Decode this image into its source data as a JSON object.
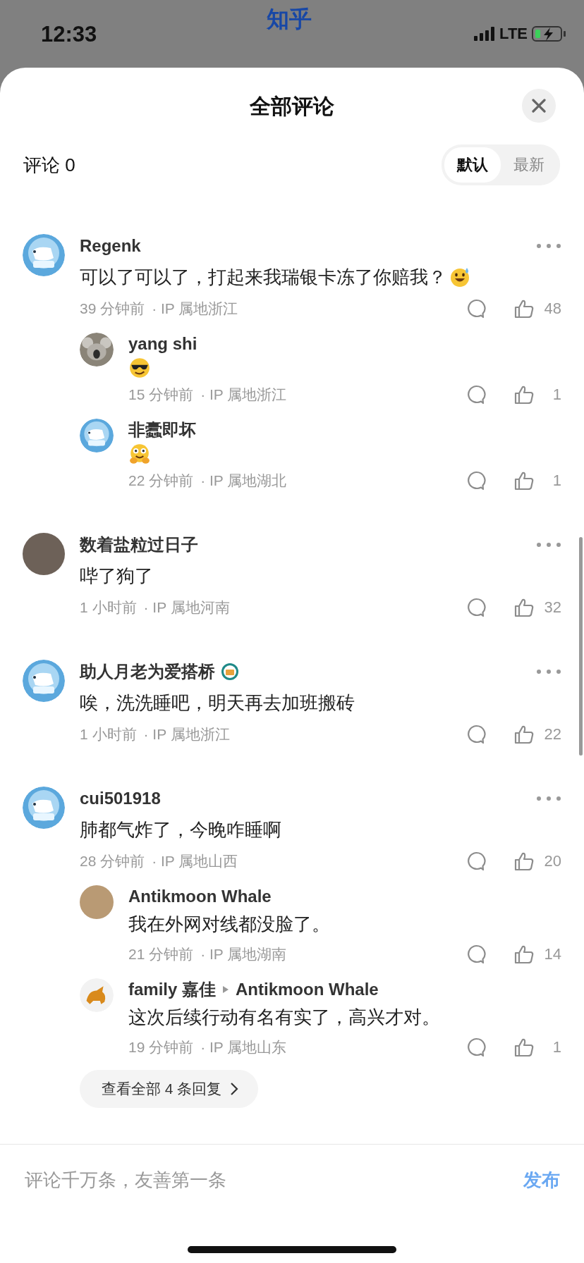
{
  "status_bar": {
    "time": "12:33",
    "app_label": "知乎",
    "network": "LTE"
  },
  "sheet": {
    "title": "全部评论",
    "count_label": "评论 0",
    "sort_tabs": [
      {
        "label": "默认",
        "selected": true
      },
      {
        "label": "最新",
        "selected": false
      }
    ]
  },
  "comments": [
    {
      "avatar": {
        "kind": "bear"
      },
      "name": "Regenk",
      "body": "可以了可以了，打起来我瑞银卡冻了你赔我？",
      "emoji": {
        "kind": "sweat"
      },
      "time": "39 分钟前",
      "location": "· IP 属地浙江",
      "likes": "48",
      "badge": false,
      "replies": [
        {
          "avatar": {
            "kind": "koala"
          },
          "name": "yang shi",
          "emoji": {
            "kind": "cool"
          },
          "time": "15 分钟前",
          "location": "· IP 属地浙江",
          "likes": "1"
        },
        {
          "avatar": {
            "kind": "bear"
          },
          "name": "非蠹即坏",
          "emoji": {
            "kind": "hug"
          },
          "time": "22 分钟前",
          "location": "· IP 属地湖北",
          "likes": "1"
        }
      ]
    },
    {
      "avatar": {
        "kind": "photo"
      },
      "name": "数着盐粒过日子",
      "body": "哔了狗了",
      "time": "1 小时前",
      "location": "· IP 属地河南",
      "likes": "32",
      "badge": false
    },
    {
      "avatar": {
        "kind": "bear"
      },
      "name": "助人月老为爱搭桥",
      "body": "唉，洗洗睡吧，明天再去加班搬砖",
      "time": "1 小时前",
      "location": "· IP 属地浙江",
      "likes": "22",
      "badge": true
    },
    {
      "avatar": {
        "kind": "bear"
      },
      "name": "cui501918",
      "body": "肺都气炸了，今晚咋睡啊",
      "time": "28 分钟前",
      "location": "· IP 属地山西",
      "likes": "20",
      "badge": false,
      "replies": [
        {
          "avatar": {
            "kind": "painting"
          },
          "name": "Antikmoon Whale",
          "body": "我在外网对线都没脸了。",
          "time": "21 分钟前",
          "location": "· IP 属地湖南",
          "likes": "14"
        },
        {
          "avatar": {
            "kind": "bull"
          },
          "name": "family 嘉佳",
          "reply_to": "Antikmoon Whale",
          "body": "这次后续行动有名有实了，高兴才对。",
          "time": "19 分钟前",
          "location": "· IP 属地山东",
          "likes": "1"
        }
      ],
      "more_replies": "查看全部 4 条回复"
    }
  ],
  "composer": {
    "placeholder": "评论千万条，友善第一条",
    "send": "发布"
  }
}
